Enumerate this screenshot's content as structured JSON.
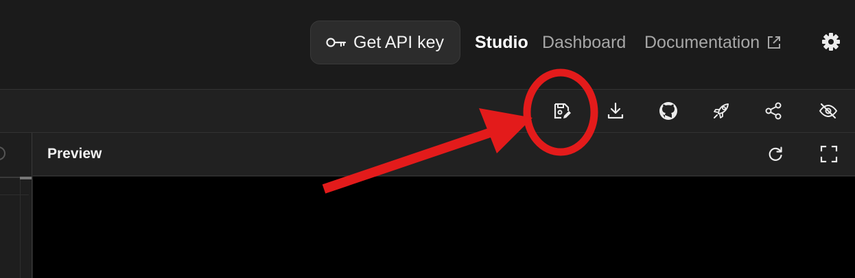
{
  "header": {
    "api_button_label": "Get API key",
    "nav": {
      "studio": "Studio",
      "dashboard": "Dashboard",
      "documentation": "Documentation"
    },
    "icons": [
      "key-icon",
      "external-link-icon",
      "gear-icon"
    ]
  },
  "toolbar": {
    "icons": [
      "save-edit-icon",
      "download-icon",
      "github-icon",
      "rocket-icon",
      "share-icon",
      "hide-preview-icon"
    ]
  },
  "preview": {
    "title": "Preview",
    "icons": [
      "refresh-icon",
      "fullscreen-icon"
    ]
  },
  "annotation": {
    "color": "#e31b1b",
    "target": "save-edit-icon"
  },
  "colors": {
    "background": "#1b1b1b",
    "panel": "#212121",
    "preview_area": "#000000",
    "text_muted": "#a7a7a7"
  }
}
